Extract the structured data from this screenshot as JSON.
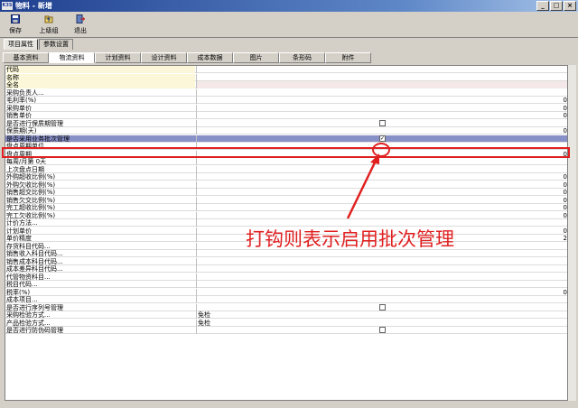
{
  "window": {
    "title": "物料 - 新增",
    "app_badge": "K3S",
    "minimize": "_",
    "maximize": "□",
    "close": "×"
  },
  "toolbar": {
    "save": "保存",
    "parent_group": "上级组",
    "exit": "退出"
  },
  "top_tabs": [
    "项目属性",
    "参数设置"
  ],
  "sub_tabs": [
    "基本资料",
    "物流资料",
    "计划资料",
    "设计资料",
    "成本数据",
    "图片",
    "条形码",
    "附件"
  ],
  "active_sub_tab": "物流资料",
  "rows": [
    {
      "label": "代码",
      "value": "",
      "type": "text"
    },
    {
      "label": "名称",
      "value": "",
      "type": "text"
    },
    {
      "label": "全名",
      "value": "",
      "type": "text"
    },
    {
      "label": "采购负责人...",
      "value": "",
      "type": "text"
    },
    {
      "label": "毛利率(%)",
      "value": "0",
      "type": "num"
    },
    {
      "label": "采购单价",
      "value": "0",
      "type": "num"
    },
    {
      "label": "销售单价",
      "value": "0",
      "type": "num"
    },
    {
      "label": "是否进行保质期管理",
      "value": "",
      "type": "check",
      "checked": false
    },
    {
      "label": "保质期(天)",
      "value": "0",
      "type": "num"
    },
    {
      "label": "是否采用业务批次管理",
      "value": "",
      "type": "check",
      "checked": true
    },
    {
      "label": "盘点周期单位...",
      "value": "",
      "type": "text"
    },
    {
      "label": "盘点周期",
      "value": "0",
      "type": "num"
    },
    {
      "label": "每周/月第 0天",
      "value": "",
      "type": "text"
    },
    {
      "label": "上次盘点日期",
      "value": "",
      "type": "text"
    },
    {
      "label": "外购超收比例(%)",
      "value": "0",
      "type": "num"
    },
    {
      "label": "外购欠收比例(%)",
      "value": "0",
      "type": "num"
    },
    {
      "label": "销售超交比例(%)",
      "value": "0",
      "type": "num"
    },
    {
      "label": "销售欠交比例(%)",
      "value": "0",
      "type": "num"
    },
    {
      "label": "完工超收比例(%)",
      "value": "0",
      "type": "num"
    },
    {
      "label": "完工欠收比例(%)",
      "value": "0",
      "type": "num"
    },
    {
      "label": "计价方法...",
      "value": "",
      "type": "text"
    },
    {
      "label": "计划单价",
      "value": "0",
      "type": "num"
    },
    {
      "label": "单价精度",
      "value": "2",
      "type": "num"
    },
    {
      "label": "存货科目代码...",
      "value": "",
      "type": "text"
    },
    {
      "label": "销售收入科目代码...",
      "value": "",
      "type": "text"
    },
    {
      "label": "销售成本科目代码...",
      "value": "",
      "type": "text"
    },
    {
      "label": "成本差异科目代码...",
      "value": "",
      "type": "text"
    },
    {
      "label": "代管物资科目...",
      "value": "",
      "type": "text"
    },
    {
      "label": "税目代码...",
      "value": "",
      "type": "text"
    },
    {
      "label": "税率(%)",
      "value": "0",
      "type": "num"
    },
    {
      "label": "成本项目...",
      "value": "",
      "type": "text"
    },
    {
      "label": "是否进行序列号管理",
      "value": "",
      "type": "check",
      "checked": false
    },
    {
      "label": "采购检验方式...",
      "value": "免检",
      "type": "text"
    },
    {
      "label": "产品检验方式...",
      "value": "免检",
      "type": "text"
    },
    {
      "label": "是否进行防伪码管理",
      "value": "",
      "type": "check",
      "checked": false
    }
  ],
  "annotation": "打钩则表示启用批次管理",
  "colors": {
    "highlight": "#e02020",
    "selected_row": "#8890c8"
  }
}
